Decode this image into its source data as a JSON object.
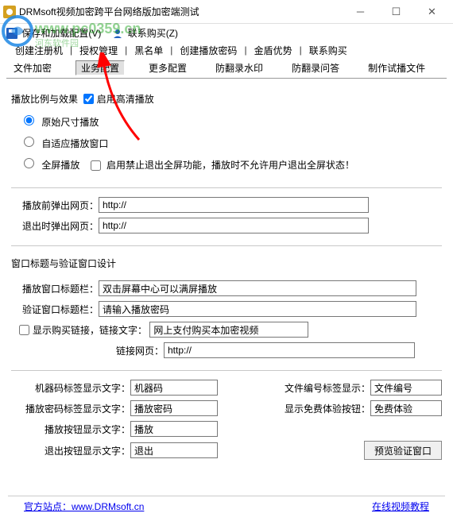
{
  "window": {
    "title": "DRMsoft视频加密跨平台网络版加密端测试"
  },
  "menu": {
    "save": "保存和加载配置(V)",
    "contact": "联系购买(Z)"
  },
  "toolbar_top": {
    "items": [
      "创建注册机",
      "授权管理",
      "黑名单",
      "创建播放密码",
      "金盾优势",
      "联系购买"
    ]
  },
  "toolbar_tabs": {
    "items": [
      "文件加密",
      "业务配置",
      "更多配置",
      "防翻录水印",
      "防翻录问答",
      "制作试播文件"
    ]
  },
  "section1": {
    "ratio_label": "播放比例与效果",
    "hd_enable": "启用高清播放",
    "opt_original": "原始尺寸播放",
    "opt_adaptive": "自适应播放窗口",
    "opt_fullscreen": "全屏播放",
    "no_exit_fs": "启用禁止退出全屏功能，播放时不允许用户退出全屏状态！"
  },
  "section2": {
    "pre_popup": "播放前弹出网页：",
    "exit_popup": "退出时弹出网页：",
    "url_val": "http://"
  },
  "section3": {
    "heading": "窗口标题与验证窗口设计",
    "play_title_lbl": "播放窗口标题栏：",
    "play_title_val": "双击屏幕中心可以满屏播放",
    "verify_title_lbl": "验证窗口标题栏：",
    "verify_title_val": "请输入播放密码",
    "show_link": "显示购买链接，链接文字：",
    "link_text_val": "网上支付购买本加密视频",
    "link_url_lbl": "链接网页：",
    "link_url_val": "http://"
  },
  "section4": {
    "mc_label_lbl": "机器码标签显示文字：",
    "mc_label_val": "机器码",
    "pwd_label_lbl": "播放密码标签显示文字：",
    "pwd_label_val": "播放密码",
    "play_btn_lbl": "播放按钮显示文字：",
    "play_btn_val": "播放",
    "exit_btn_lbl": "退出按钮显示文字：",
    "exit_btn_val": "退出",
    "file_no_lbl": "文件编号标签显示：",
    "file_no_val": "文件编号",
    "free_try_lbl": "显示免费体验按钮：",
    "free_try_val": "免费体验",
    "preview_btn": "预览验证窗口"
  },
  "footer": {
    "official": "官方站点：",
    "url": "www.DRMsoft.cn",
    "tutorial": "在线视频教程"
  },
  "watermark": {
    "text": "www.pc0359.cn",
    "brand": "河东软件园"
  }
}
